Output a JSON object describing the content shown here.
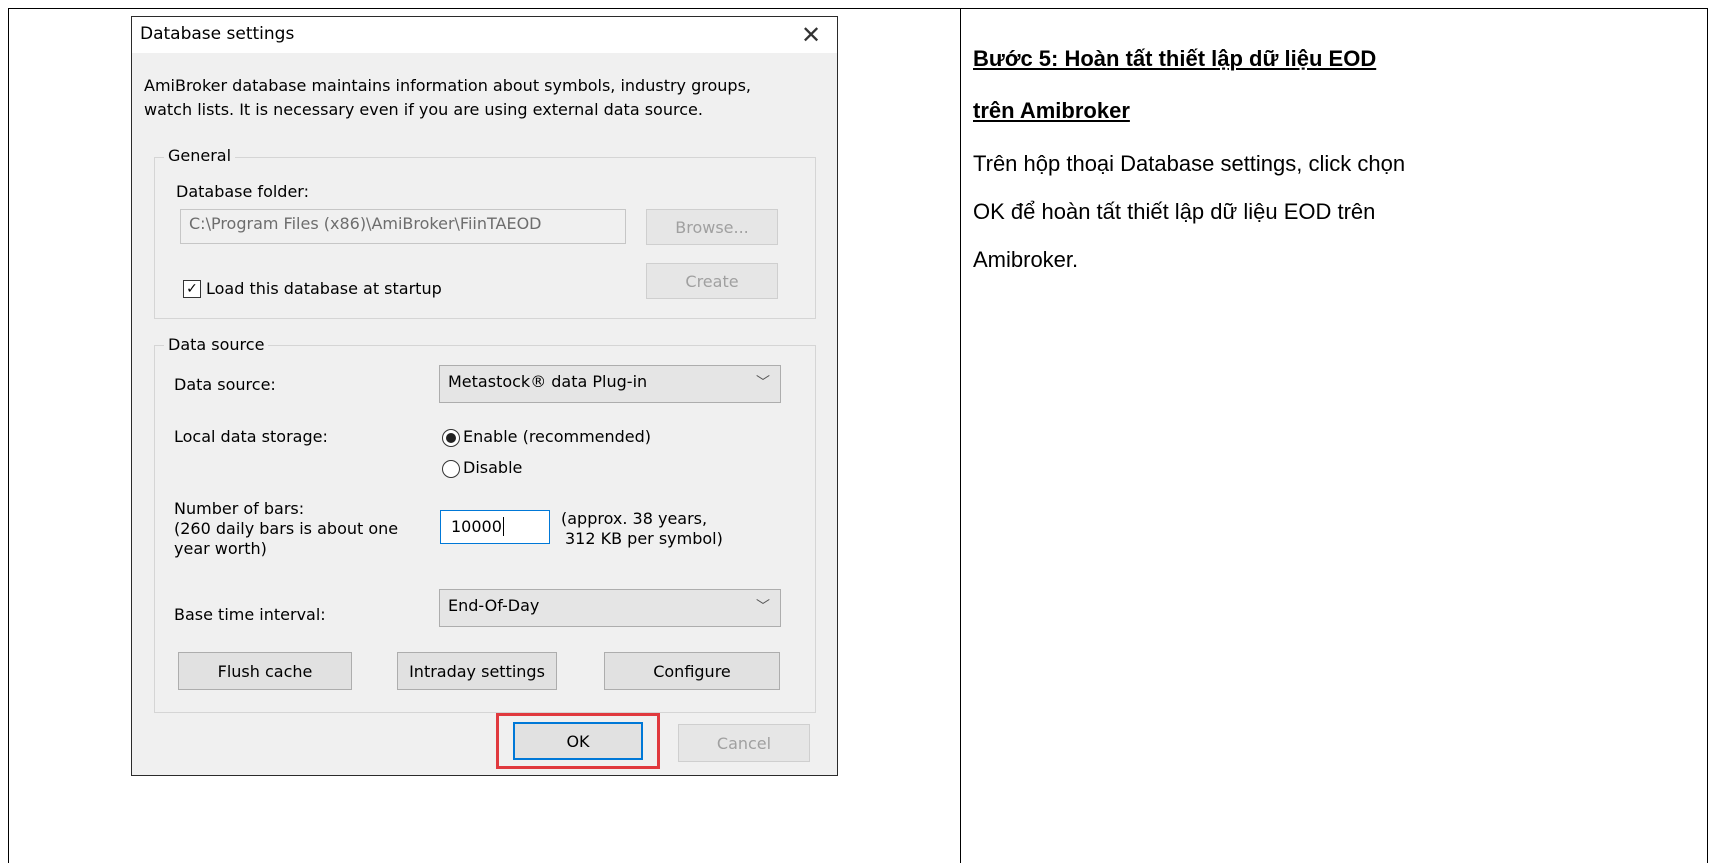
{
  "dialog": {
    "title": "Database settings",
    "description_line1": "AmiBroker database maintains information about symbols, industry groups,",
    "description_line2": "watch lists. It is necessary even if you are using external data source.",
    "general": {
      "legend": "General",
      "folder_label": "Database folder:",
      "folder_value": "C:\\Program Files (x86)\\AmiBroker\\FiinTAEOD",
      "browse_button": "Browse...",
      "create_button": "Create",
      "load_checkbox_label": "Load this database at startup",
      "load_checked": true
    },
    "data_source": {
      "legend": "Data source",
      "source_label": "Data source:",
      "source_value": "Metastock® data Plug-in",
      "storage_label": "Local data storage:",
      "storage_options": [
        "Enable (recommended)",
        "Disable"
      ],
      "storage_selected": 0,
      "bars_label_line1": "Number of bars:",
      "bars_label_line2": "(260 daily bars is about one",
      "bars_label_line3": "year worth)",
      "bars_value": "10000",
      "bars_note_line1": "(approx. 38 years,",
      "bars_note_line2": "312 KB per symbol)",
      "interval_label": "Base time interval:",
      "interval_value": "End-Of-Day",
      "flush_button": "Flush cache",
      "intraday_button": "Intraday settings",
      "configure_button": "Configure"
    },
    "ok_button": "OK",
    "cancel_button": "Cancel"
  },
  "instructions": {
    "heading_line1": "Bước 5: Hoàn tất thiết lập dữ liệu EOD",
    "heading_line2": "trên Amibroker",
    "body_line1": "Trên hộp thoại Database settings, click chọn",
    "body_line2": "OK để hoàn tất thiết lập dữ liệu EOD trên",
    "body_line3": "Amibroker."
  },
  "colors": {
    "highlight": "#e0393e",
    "focus": "#0078d7"
  }
}
